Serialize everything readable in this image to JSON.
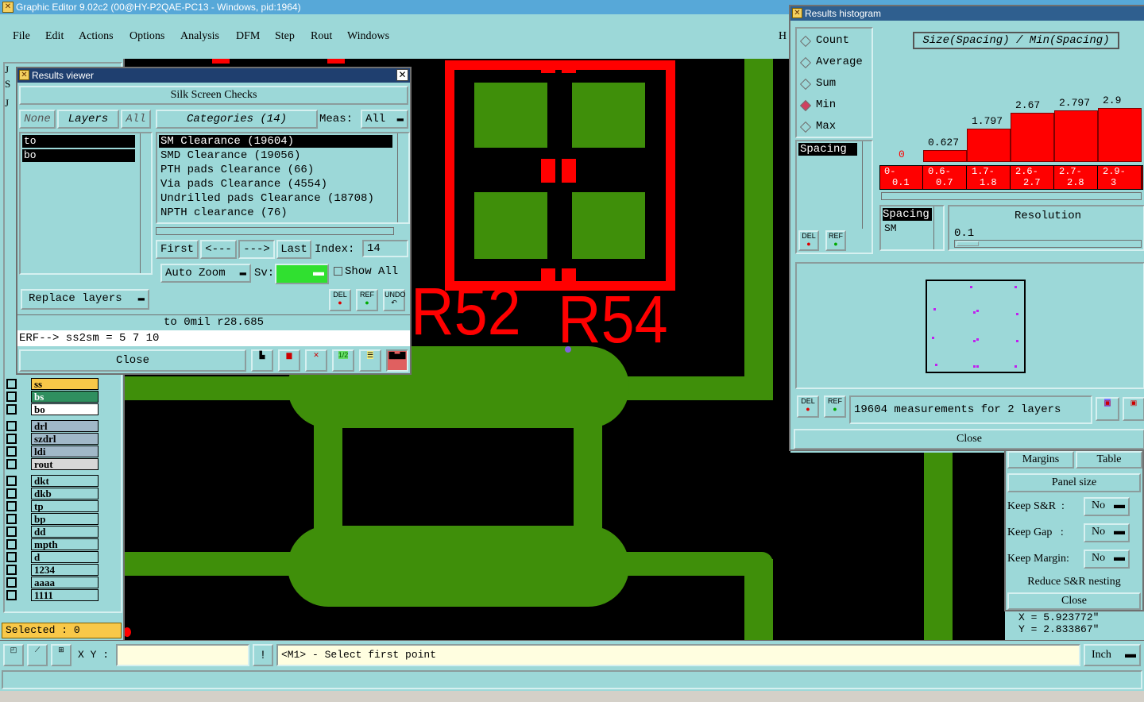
{
  "app": {
    "title": "Graphic Editor 9.02c2 (00@HY-P2QAE-PC13 - Windows, pid:1964)"
  },
  "menu": [
    "File",
    "Edit",
    "Actions",
    "Options",
    "Analysis",
    "DFM",
    "Step",
    "Rout",
    "Windows"
  ],
  "menu_right_char": "H",
  "left_panel": {
    "letters": [
      "J",
      "S",
      "J"
    ],
    "layers": [
      {
        "name": "ss",
        "color": "#f8c848"
      },
      {
        "name": "bs",
        "color": "#2f8f5f"
      },
      {
        "name": "bo",
        "color": "#ffffff"
      },
      {
        "name": "drl",
        "color": "#a0b8c8"
      },
      {
        "name": "szdrl",
        "color": "#a0b8c8"
      },
      {
        "name": "ldi",
        "color": "#a0b8c8"
      },
      {
        "name": "rout",
        "color": "#d8d8d8"
      },
      {
        "name": "dkt",
        "color": "#9cd8d8"
      },
      {
        "name": "dkb",
        "color": "#9cd8d8"
      },
      {
        "name": "tp",
        "color": "#9cd8d8"
      },
      {
        "name": "bp",
        "color": "#9cd8d8"
      },
      {
        "name": "dd",
        "color": "#9cd8d8"
      },
      {
        "name": "mpth",
        "color": "#9cd8d8"
      },
      {
        "name": "d",
        "color": "#9cd8d8"
      },
      {
        "name": "1234",
        "color": "#9cd8d8"
      },
      {
        "name": "aaaa",
        "color": "#9cd8d8"
      },
      {
        "name": "1111",
        "color": "#9cd8d8"
      }
    ],
    "selected": "Selected : 0"
  },
  "canvas": {
    "text1": "R52",
    "text2": "R54"
  },
  "results_viewer": {
    "title": "Results viewer",
    "header": "Silk Screen Checks",
    "none_btn": "None",
    "layers_btn": "Layers",
    "all_btn": "All",
    "layer_list": [
      "to",
      "bo"
    ],
    "categories_btn": "Categories (14)",
    "meas_label": "Meas:",
    "meas_value": "All",
    "categories": [
      "SM Clearance (19604)",
      "SMD Clearance (19056)",
      "PTH pads Clearance (66)",
      "Via pads Clearance (4554)",
      "Undrilled pads Clearance (18708)",
      "NPTH clearance (76)"
    ],
    "first": "First",
    "prev": "<---",
    "next": "--->",
    "last": "Last",
    "index_label": "Index:",
    "index_value": "14",
    "auto_zoom": "Auto Zoom",
    "sv_label": "Sv:",
    "show_all": "Show All",
    "replace_layers": "Replace layers",
    "del": "DEL",
    "ref": "REF",
    "undo": "UNDO",
    "status_line": "to 0mil   r28.685",
    "erf_line": "ERF--> ss2sm = 5 7 10",
    "close": "Close"
  },
  "histogram": {
    "title": "Results histogram",
    "options": [
      {
        "label": "Count",
        "selected": false
      },
      {
        "label": "Average",
        "selected": false
      },
      {
        "label": "Sum",
        "selected": false
      },
      {
        "label": "Min",
        "selected": true
      },
      {
        "label": "Max",
        "selected": false
      }
    ],
    "header": "Size(Spacing) / Min(Spacing)",
    "list_item": "Spacing",
    "chart_data": {
      "type": "bar",
      "categories": [
        "0-0.1",
        "0.6-0.7",
        "1.7-1.8",
        "2.6-2.7",
        "2.7-2.8",
        "2.9-3"
      ],
      "values": [
        0,
        0.627,
        1.797,
        2.67,
        2.797,
        2.9
      ],
      "value_labels": [
        "0",
        "0.627",
        "1.797",
        "2.67",
        "2.797",
        "2.9"
      ],
      "ylim": [
        0,
        3
      ]
    },
    "bin_labels_top": [
      "0-",
      "0.6-",
      "1.7-",
      "2.6-",
      "2.7-",
      "2.9-"
    ],
    "bin_labels_bottom": [
      "0.1",
      "0.7",
      "1.8",
      "2.7",
      "2.8",
      "3"
    ],
    "spacing_box": [
      "Spacing",
      "SM"
    ],
    "resolution_label": "Resolution",
    "resolution_value": "0.1",
    "measurements": "19604 measurements for 2 layers",
    "del": "DEL",
    "ref": "REF",
    "close": "Close"
  },
  "panel_right": {
    "margins": "Margins",
    "table": "Table",
    "panel_size": "Panel size",
    "keep_sr": "Keep S&R  :",
    "keep_gap": "Keep Gap   :",
    "keep_margin": "Keep Margin:",
    "no": "No",
    "reduce": "Reduce S&R nesting",
    "close": "Close",
    "x": "X = 5.923772\"",
    "y": "Y = 2.833867\""
  },
  "bottom": {
    "xy_label": "X Y :",
    "prompt": "<M1> - Select first point",
    "unit": "Inch"
  }
}
